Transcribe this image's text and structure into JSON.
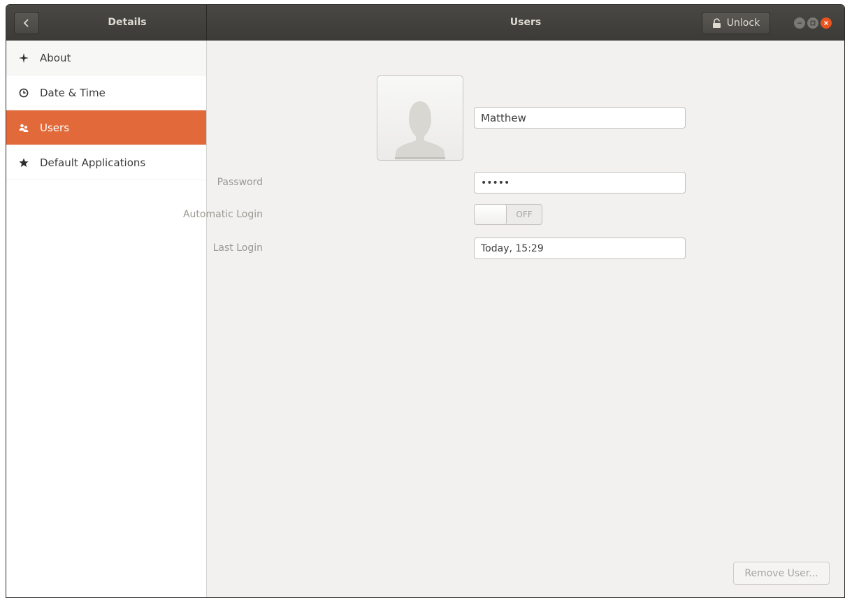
{
  "header": {
    "left_title": "Details",
    "title": "Users",
    "unlock_label": "Unlock"
  },
  "sidebar": {
    "items": [
      {
        "label": "About",
        "icon": "sparkle-icon"
      },
      {
        "label": "Date & Time",
        "icon": "clock-icon"
      },
      {
        "label": "Users",
        "icon": "users-icon",
        "active": true
      },
      {
        "label": "Default Applications",
        "icon": "star-icon"
      }
    ]
  },
  "user": {
    "name": "Matthew",
    "password_label": "Password",
    "password_value": "•••••",
    "autologin_label": "Automatic Login",
    "autologin_state": "OFF",
    "lastlogin_label": "Last Login",
    "lastlogin_value": "Today, 15:29",
    "remove_label": "Remove User..."
  },
  "colors": {
    "accent": "#e1693a",
    "headerbar": "#3c3b37",
    "close": "#e95420"
  }
}
